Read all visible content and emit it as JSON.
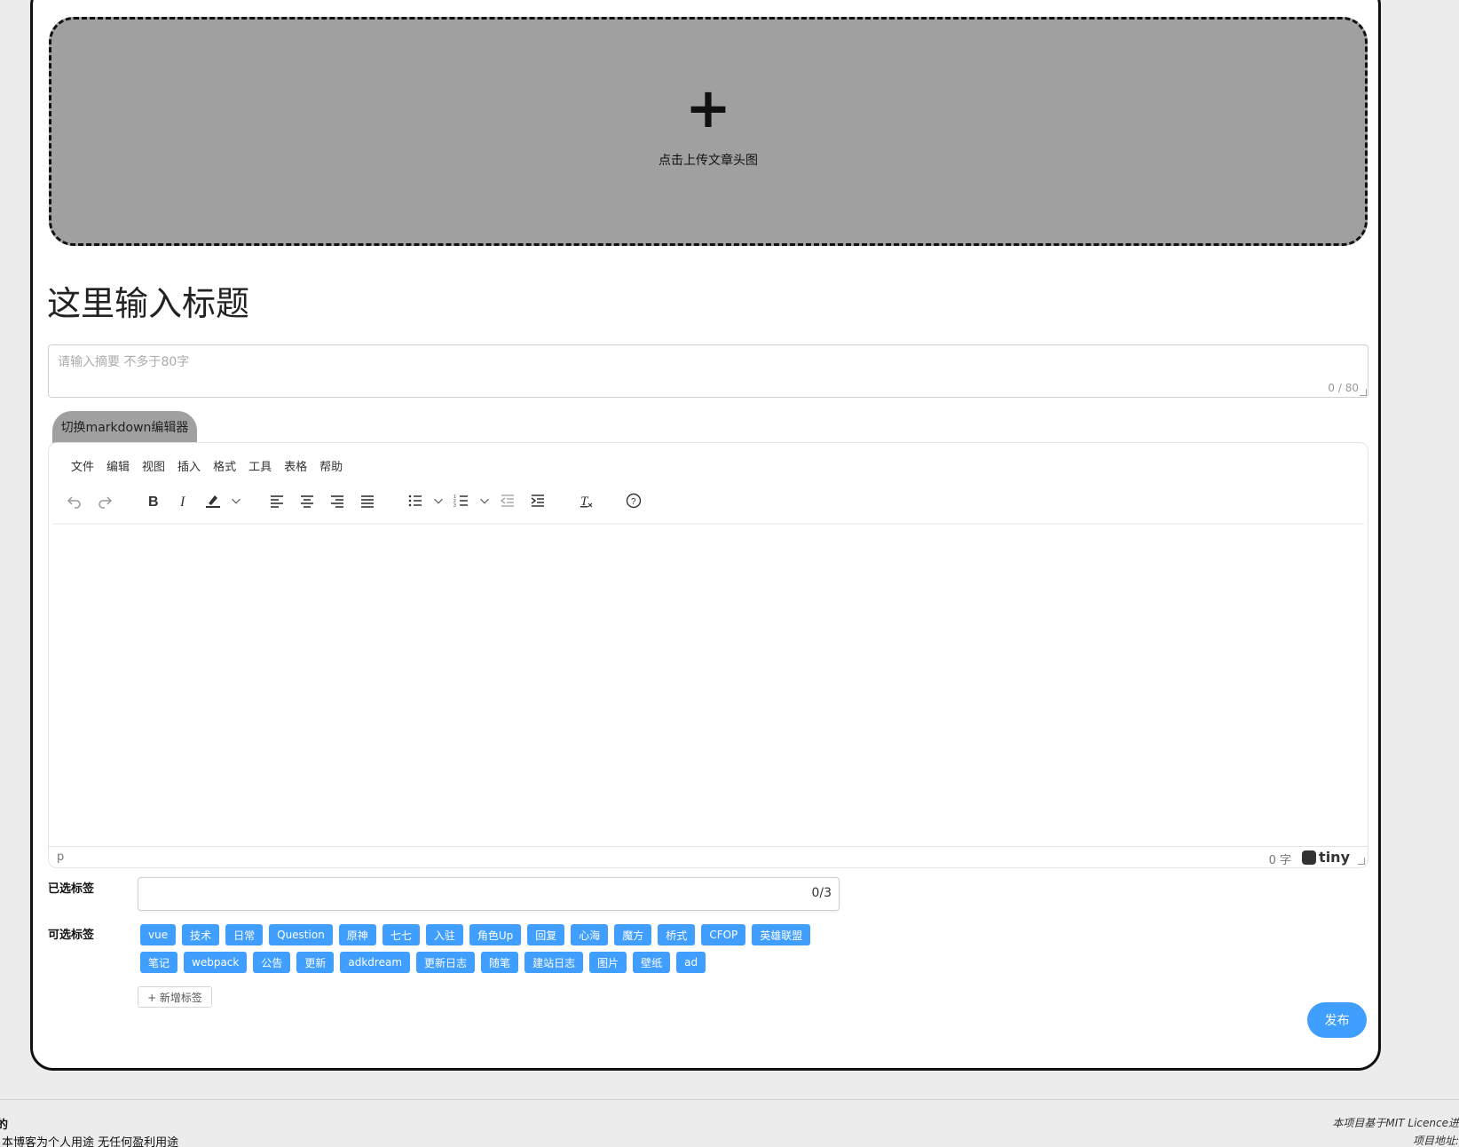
{
  "upload": {
    "plus": "+",
    "text": "点击上传文章头图"
  },
  "title": {
    "placeholder": "这里输入标题"
  },
  "summary": {
    "placeholder": "请输入摘要 不多于80字",
    "count": "0 / 80"
  },
  "editor_switch": {
    "label": "切换markdown编辑器"
  },
  "editor": {
    "menu": [
      "文件",
      "编辑",
      "视图",
      "插入",
      "格式",
      "工具",
      "表格",
      "帮助"
    ],
    "status_path": "p",
    "word_count": "0 字",
    "brand": "tiny",
    "toolbar_icons": [
      "undo-icon",
      "redo-icon",
      "bold-icon",
      "italic-icon",
      "highlight-icon",
      "align-left-icon",
      "align-center-icon",
      "align-right-icon",
      "justify-icon",
      "bullet-list-icon",
      "numbered-list-icon",
      "outdent-icon",
      "indent-icon",
      "clear-format-icon",
      "help-icon"
    ]
  },
  "tags": {
    "selected_label": "已选标签",
    "selected_count": "0/3",
    "optional_label": "可选标签",
    "options": [
      "vue",
      "技术",
      "日常",
      "Question",
      "原神",
      "七七",
      "入驻",
      "角色Up",
      "回复",
      "心海",
      "魔方",
      "桥式",
      "CFOP",
      "英雄联盟",
      "笔记",
      "webpack",
      "公告",
      "更新",
      "adkdream",
      "更新日志",
      "随笔",
      "建站日志",
      "图片",
      "壁纸",
      "ad"
    ],
    "new_tag": "+ 新增标签"
  },
  "publish": {
    "label": "发布"
  },
  "footer": {
    "left_mark": "的",
    "left_text": "本博客为个人用途 无任何盈利用途",
    "right_line1": "本项目基于MIT Licence进",
    "right_line2": "项目地址:"
  },
  "colors": {
    "accent": "#409eff",
    "upload_bg": "#a0a0a0"
  }
}
